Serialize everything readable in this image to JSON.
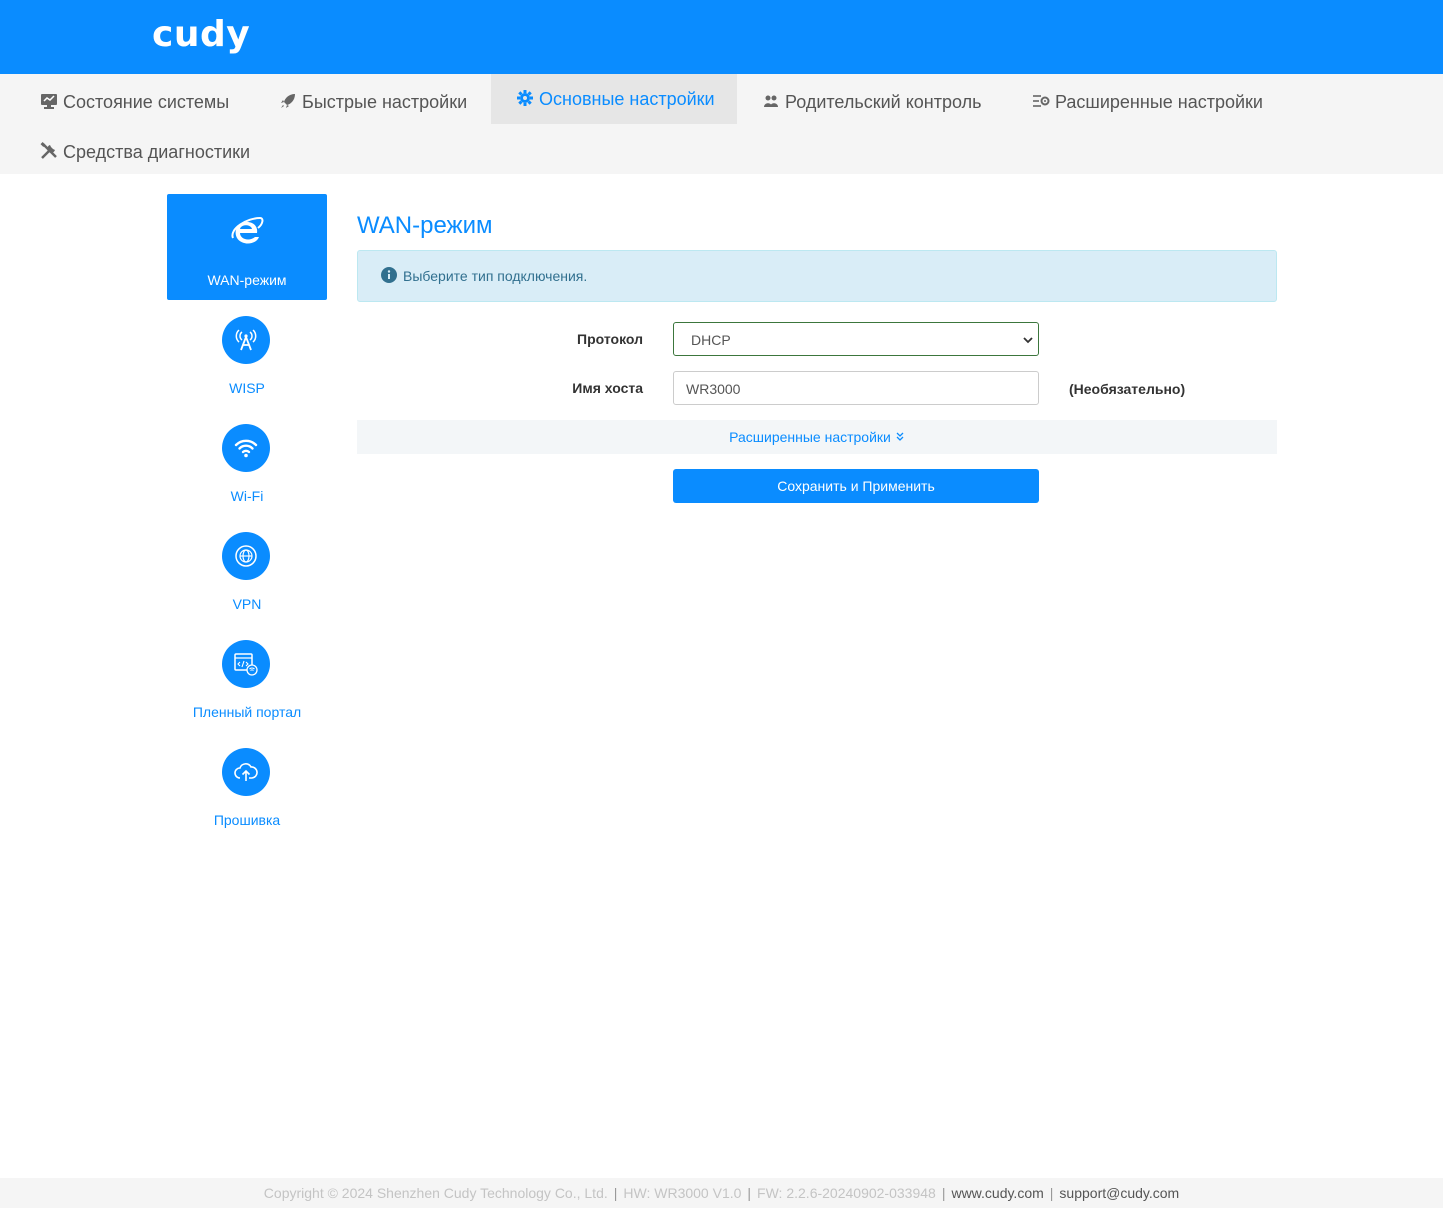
{
  "brand": {
    "logo_text": "cudy",
    "primary_color": "#0a8cff"
  },
  "top_nav": {
    "items": [
      {
        "label": "Состояние системы",
        "icon": "monitor-icon",
        "active": false
      },
      {
        "label": "Быстрые настройки",
        "icon": "rocket-icon",
        "active": false
      },
      {
        "label": "Основные настройки",
        "icon": "gear-icon",
        "active": true
      },
      {
        "label": "Родительский контроль",
        "icon": "users-icon",
        "active": false
      },
      {
        "label": "Расширенные настройки",
        "icon": "advanced-settings-icon",
        "active": false
      },
      {
        "label": "Средства диагностики",
        "icon": "tools-icon",
        "active": false
      }
    ]
  },
  "sidebar": {
    "items": [
      {
        "label": "WAN-режим",
        "icon": "internet-explorer-icon",
        "active": true
      },
      {
        "label": "WISP",
        "icon": "antenna-icon",
        "active": false
      },
      {
        "label": "Wi-Fi",
        "icon": "wifi-icon",
        "active": false
      },
      {
        "label": "VPN",
        "icon": "globe-icon",
        "active": false
      },
      {
        "label": "Пленный портал",
        "icon": "portal-icon",
        "active": false
      },
      {
        "label": "Прошивка",
        "icon": "cloud-upload-icon",
        "active": false
      }
    ]
  },
  "main": {
    "title": "WAN-режим",
    "alert": {
      "icon": "info-icon",
      "text": "Выберите тип подключения."
    },
    "form": {
      "protocol_label": "Протокол",
      "protocol_value": "DHCP",
      "hostname_label": "Имя хоста",
      "hostname_value": "WR3000",
      "hostname_hint": "(Необязательно)"
    },
    "advanced_toggle": "Расширенные настройки",
    "save_button": "Сохранить и Применить"
  },
  "footer": {
    "copyright": "Copyright © 2024 Shenzhen Cudy Technology Co., Ltd.",
    "hw": "HW: WR3000 V1.0",
    "fw": "FW: 2.2.6-20240902-033948",
    "website": "www.cudy.com",
    "email": "support@cudy.com",
    "separator": "|"
  }
}
